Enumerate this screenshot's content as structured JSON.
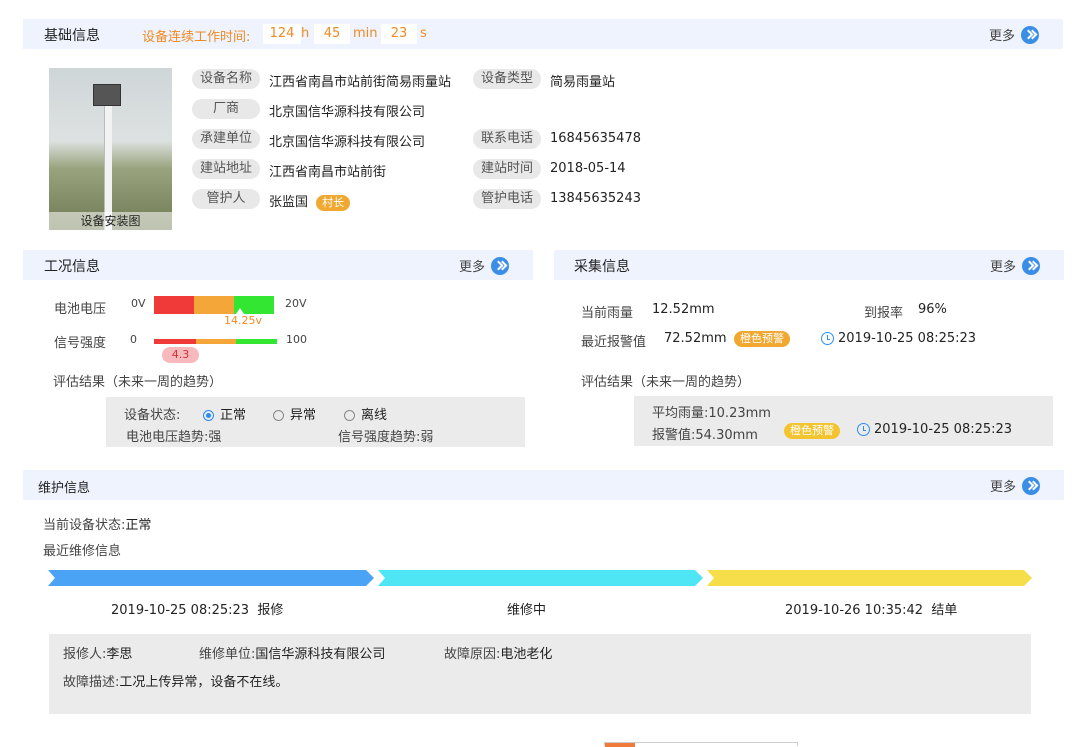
{
  "basic": {
    "title": "基础信息",
    "uptime_label": "设备连续工作时间:",
    "hours": "124",
    "h_unit": "h",
    "minutes": "45",
    "m_unit": "min",
    "seconds": "23",
    "s_unit": "s",
    "more": "更多",
    "photo_caption": "设备安装图",
    "fields": {
      "name_label": "设备名称",
      "name": "江西省南昌市站前街简易雨量站",
      "type_label": "设备类型",
      "type": "简易雨量站",
      "vendor_label": "厂商",
      "vendor": "北京国信华源科技有限公司",
      "contractor_label": "承建单位",
      "contractor": "北京国信华源科技有限公司",
      "phone_label": "联系电话",
      "phone": "16845635478",
      "address_label": "建站地址",
      "address": "江西省南昌市站前街",
      "build_time_label": "建站时间",
      "build_time": "2018-05-14",
      "keeper_label": "管护人",
      "keeper": "张监国",
      "keeper_badge": "村长",
      "keeper_phone_label": "管护电话",
      "keeper_phone": "13845635243"
    }
  },
  "condition": {
    "title": "工况信息",
    "more": "更多",
    "battery_label": "电池电压",
    "battery_min": "0V",
    "battery_max": "20V",
    "battery_value": "14.25v",
    "battery_fraction": 0.7125,
    "signal_label": "信号强度",
    "signal_min": "0",
    "signal_max": "100",
    "signal_value": "4.3",
    "signal_fraction": 0.2,
    "eval_title": "评估结果（未来一周的趋势）",
    "status_label": "设备状态:",
    "status_options": [
      "正常",
      "异常",
      "离线"
    ],
    "battery_trend_label": "电池电压趋势:",
    "battery_trend": "强",
    "signal_trend_label": "信号强度趋势:",
    "signal_trend": "弱"
  },
  "collection": {
    "title": "采集信息",
    "more": "更多",
    "current_rain_label": "当前雨量",
    "current_rain": "12.52mm",
    "report_rate_label": "到报率",
    "report_rate": "96%",
    "last_alarm_label": "最近报警值",
    "last_alarm": "72.52mm",
    "alarm_badge": "橙色预警",
    "alarm_time": "2019-10-25 08:25:23",
    "eval_title": "评估结果（未来一周的趋势）",
    "avg_rain_label": "平均雨量:",
    "avg_rain": "10.23mm",
    "alarm_value_label": "报警值:",
    "alarm_value": "54.30mm",
    "alarm_badge2": "橙色预警",
    "alarm_time2": "2019-10-25 08:25:23"
  },
  "maintenance": {
    "title": "维护信息",
    "more": "更多",
    "current_status_label": "当前设备状态:",
    "current_status": "正常",
    "recent_title": "最近维修信息",
    "steps": [
      {
        "label": "2019-10-25 08:25:23  报修"
      },
      {
        "label": "维修中"
      },
      {
        "label": "2019-10-26 10:35:42  结单"
      }
    ],
    "reporter_label": "报修人:",
    "reporter": "李思",
    "unit_label": "维修单位:",
    "unit": "国信华源科技有限公司",
    "cause_label": "故障原因:",
    "cause": "电池老化",
    "desc_label": "故障描述:",
    "desc": "工况上传异常，设备不在线。"
  },
  "colors": {
    "accent": "#2d8cf0",
    "orange": "#f08a24",
    "header_bg": "#eef3fd"
  }
}
